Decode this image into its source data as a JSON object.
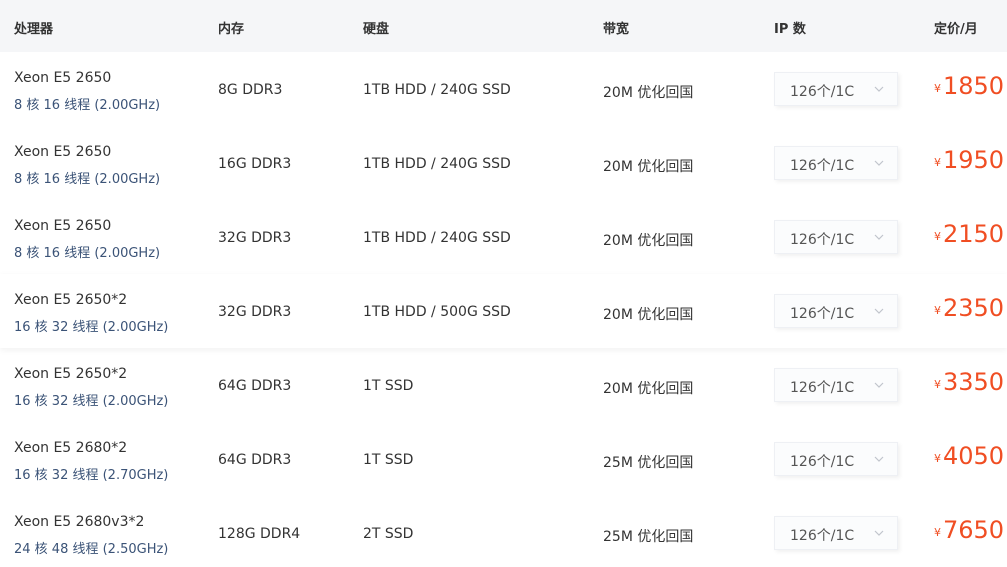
{
  "header": {
    "cpu": "处理器",
    "ram": "内存",
    "disk": "硬盘",
    "bandwidth": "带宽",
    "ip": "IP 数",
    "price": "定价/月"
  },
  "rows": [
    {
      "cpu_model": "Xeon E5 2650",
      "cpu_spec": "8 核 16 线程 (2.00GHz)",
      "ram": "8G DDR3",
      "disk": "1TB HDD / 240G SSD",
      "bandwidth": "20M 优化回国",
      "ip": "126个/1C",
      "currency": "¥",
      "price": "1850"
    },
    {
      "cpu_model": "Xeon E5 2650",
      "cpu_spec": "8 核 16 线程 (2.00GHz)",
      "ram": "16G DDR3",
      "disk": "1TB HDD / 240G SSD",
      "bandwidth": "20M 优化回国",
      "ip": "126个/1C",
      "currency": "¥",
      "price": "1950"
    },
    {
      "cpu_model": "Xeon E5 2650",
      "cpu_spec": "8 核 16 线程 (2.00GHz)",
      "ram": "32G DDR3",
      "disk": "1TB HDD / 240G SSD",
      "bandwidth": "20M 优化回国",
      "ip": "126个/1C",
      "currency": "¥",
      "price": "2150"
    },
    {
      "cpu_model": "Xeon E5 2650*2",
      "cpu_spec": "16 核 32 线程 (2.00GHz)",
      "ram": "32G DDR3",
      "disk": "1TB HDD / 500G SSD",
      "bandwidth": "20M 优化回国",
      "ip": "126个/1C",
      "currency": "¥",
      "price": "2350"
    },
    {
      "cpu_model": "Xeon E5 2650*2",
      "cpu_spec": "16 核 32 线程 (2.00GHz)",
      "ram": "64G DDR3",
      "disk": "1T SSD",
      "bandwidth": "20M 优化回国",
      "ip": "126个/1C",
      "currency": "¥",
      "price": "3350"
    },
    {
      "cpu_model": "Xeon E5 2680*2",
      "cpu_spec": "16 核 32 线程 (2.70GHz)",
      "ram": "64G DDR3",
      "disk": "1T SSD",
      "bandwidth": "25M 优化回国",
      "ip": "126个/1C",
      "currency": "¥",
      "price": "4050"
    },
    {
      "cpu_model": "Xeon E5 2680v3*2",
      "cpu_spec": "24 核 48 线程 (2.50GHz)",
      "ram": "128G DDR4",
      "disk": "2T SSD",
      "bandwidth": "25M 优化回国",
      "ip": "126个/1C",
      "currency": "¥",
      "price": "7650"
    }
  ],
  "colors": {
    "header_bg": "#f5f6f8",
    "price": "#f04e23",
    "spec_text": "#3b5377"
  },
  "icons": {
    "dropdown": "chevron-down-icon"
  }
}
